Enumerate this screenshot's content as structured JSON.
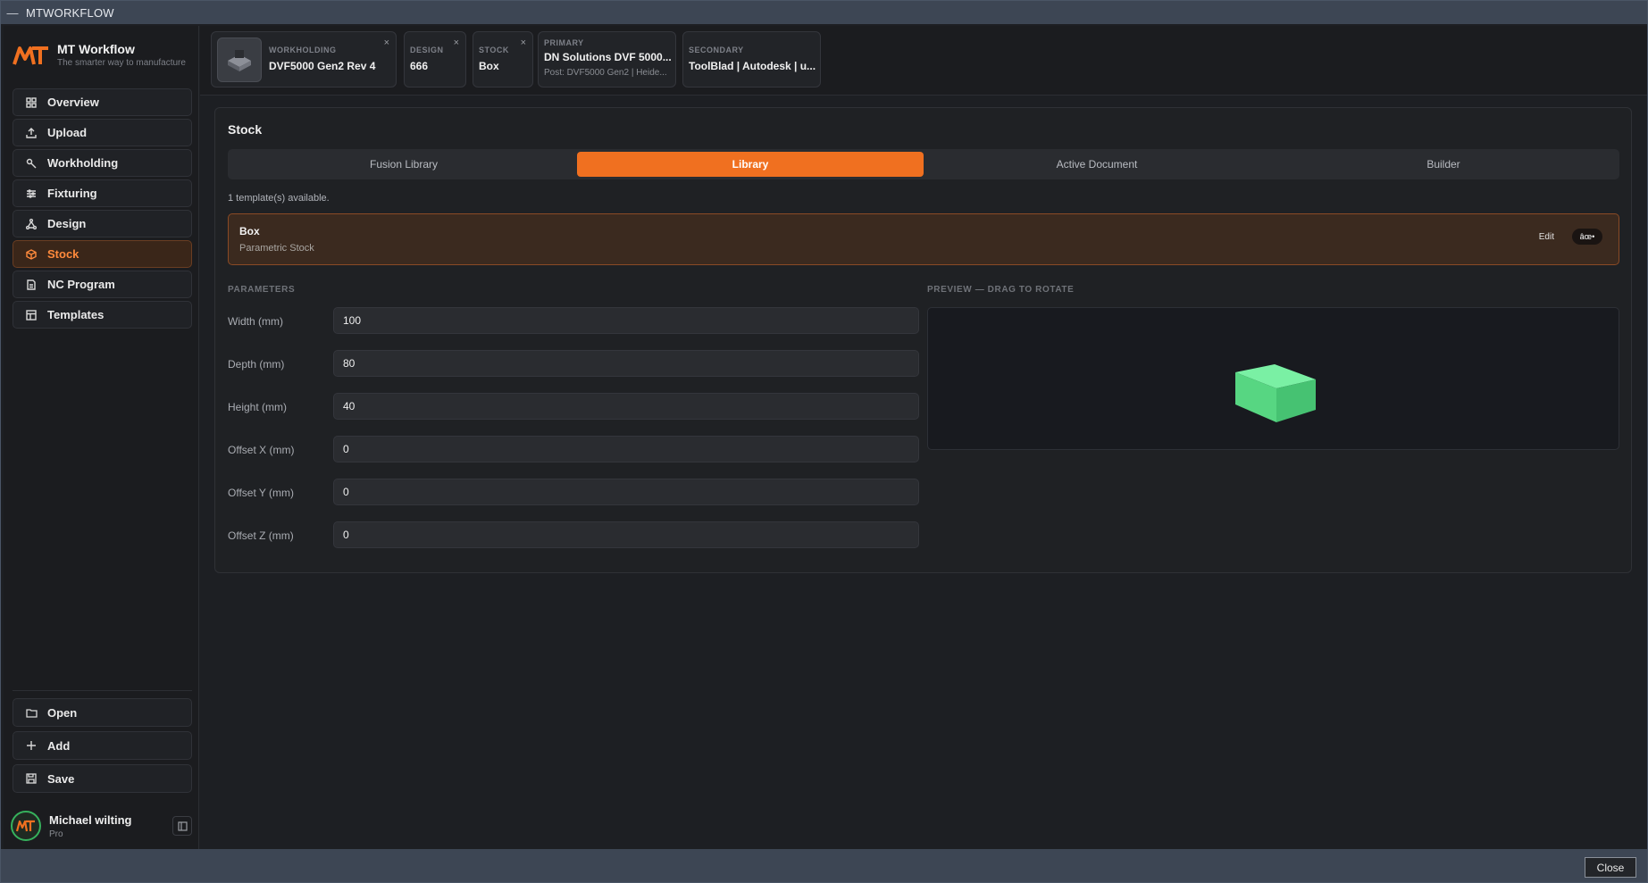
{
  "window": {
    "title": "MTWORKFLOW",
    "minimize_glyph": "—"
  },
  "brand": {
    "name": "MT Workflow",
    "tagline": "The smarter way to manufacture"
  },
  "nav": [
    {
      "label": "Overview",
      "icon": "grid-icon"
    },
    {
      "label": "Upload",
      "icon": "upload-icon"
    },
    {
      "label": "Workholding",
      "icon": "wrench-icon"
    },
    {
      "label": "Fixturing",
      "icon": "sliders-icon"
    },
    {
      "label": "Design",
      "icon": "nodes-icon"
    },
    {
      "label": "Stock",
      "icon": "box-icon",
      "active": true
    },
    {
      "label": "NC Program",
      "icon": "file-code-icon"
    },
    {
      "label": "Templates",
      "icon": "layout-icon"
    }
  ],
  "bottom_nav": [
    {
      "label": "Open",
      "icon": "folder-icon"
    },
    {
      "label": "Add",
      "icon": "plus-icon"
    },
    {
      "label": "Save",
      "icon": "save-icon"
    }
  ],
  "user": {
    "name": "Michael wilting",
    "plan": "Pro"
  },
  "chips": {
    "workholding": {
      "label": "WORKHOLDING",
      "value": "DVF5000 Gen2 Rev 4"
    },
    "design": {
      "label": "DESIGN",
      "value": "666"
    },
    "stock": {
      "label": "STOCK",
      "value": "Box"
    },
    "primary": {
      "label": "PRIMARY",
      "value": "DN Solutions DVF 5000...",
      "sub": "Post: DVF5000 Gen2 | Heide..."
    },
    "secondary": {
      "label": "SECONDARY",
      "value": "ToolBlad | Autodesk | u..."
    },
    "close_glyph": "×"
  },
  "stock": {
    "title": "Stock",
    "tabs": [
      "Fusion Library",
      "Library",
      "Active Document",
      "Builder"
    ],
    "active_tab": "Library",
    "available_text": "1 template(s) available.",
    "template": {
      "name": "Box",
      "description": "Parametric Stock",
      "edit_label": "Edit",
      "badge": "âœ•"
    },
    "parameters_heading": "PARAMETERS",
    "preview_heading": "PREVIEW — DRAG TO ROTATE",
    "params": [
      {
        "label": "Width (mm)",
        "value": "100"
      },
      {
        "label": "Depth (mm)",
        "value": "80"
      },
      {
        "label": "Height (mm)",
        "value": "40"
      },
      {
        "label": "Offset X (mm)",
        "value": "0"
      },
      {
        "label": "Offset Y (mm)",
        "value": "0"
      },
      {
        "label": "Offset Z (mm)",
        "value": "0"
      }
    ]
  },
  "footer": {
    "close_label": "Close"
  },
  "colors": {
    "accent": "#f07020",
    "preview_box": "#5fe08a",
    "avatar_ring": "#36b15c"
  }
}
